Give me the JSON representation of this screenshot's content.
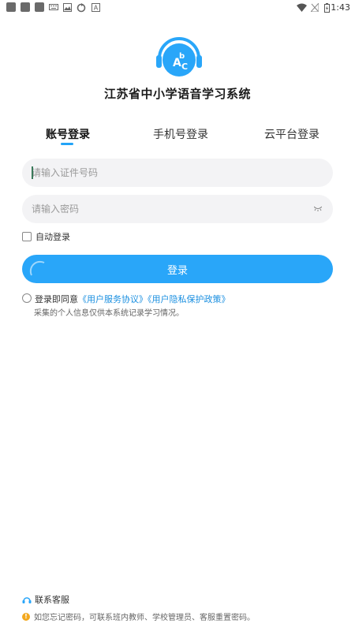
{
  "status_bar": {
    "time": "1:43"
  },
  "app": {
    "title": "江苏省中小学语音学习系统",
    "logo_letters": [
      "A",
      "b",
      "C"
    ]
  },
  "tabs": [
    {
      "label": "账号登录",
      "active": true
    },
    {
      "label": "手机号登录",
      "active": false
    },
    {
      "label": "云平台登录",
      "active": false
    }
  ],
  "form": {
    "id_placeholder": "请输入证件号码",
    "password_placeholder": "请输入密码",
    "auto_login_label": "自动登录",
    "auto_login_checked": false,
    "submit_label": "登录"
  },
  "agreement": {
    "prefix": "登录即同意",
    "service_link": "《用户服务协议》",
    "privacy_link": "《用户隐私保护政策》",
    "note": "采集的个人信息仅供本系统记录学习情况。"
  },
  "footer": {
    "contact_label": "联系客服",
    "forgot_note": "如您忘记密码，可联系班内教师、学校管理员、客服重置密码。"
  },
  "colors": {
    "accent": "#29a6f9",
    "link": "#1a8fe0",
    "warning": "#f3a81d"
  }
}
